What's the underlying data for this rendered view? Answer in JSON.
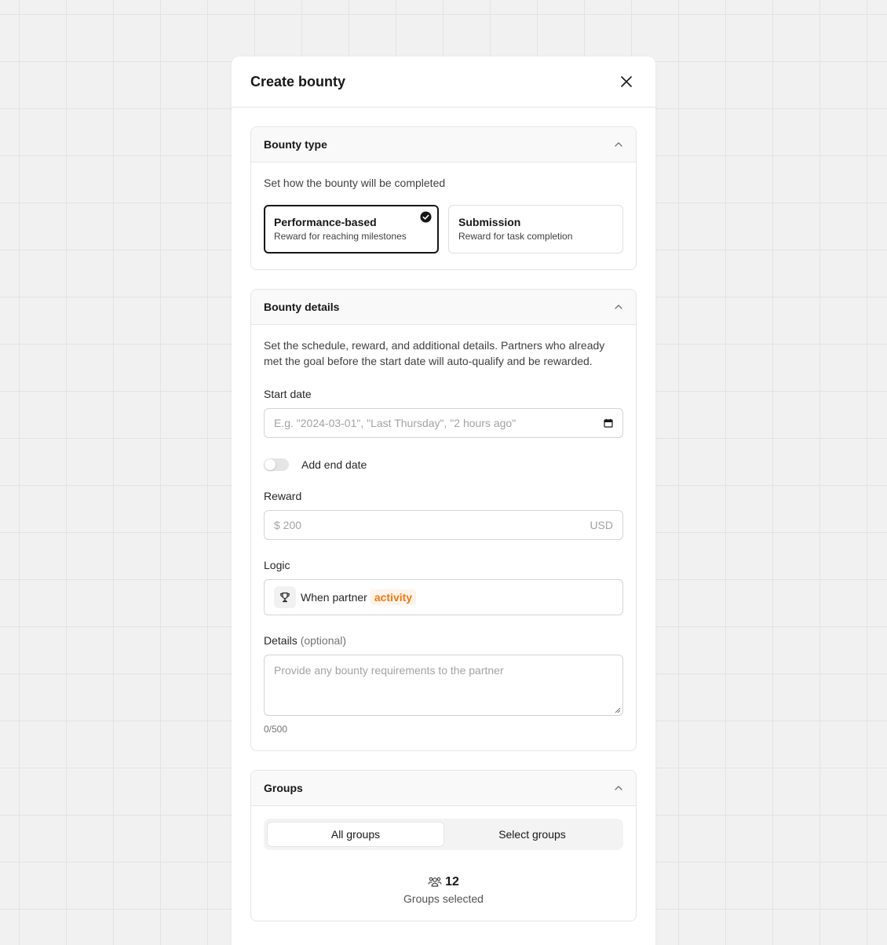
{
  "modal": {
    "title": "Create bounty"
  },
  "bounty_type": {
    "title": "Bounty type",
    "description": "Set how the bounty will be completed",
    "options": [
      {
        "name": "Performance-based",
        "description": "Reward for reaching milestones",
        "selected": true
      },
      {
        "name": "Submission",
        "description": "Reward for task completion",
        "selected": false
      }
    ]
  },
  "bounty_details": {
    "title": "Bounty details",
    "description": "Set the schedule, reward, and additional details. Partners who already met the goal before the start date will auto-qualify and be rewarded.",
    "start_date": {
      "label": "Start date",
      "placeholder": "E.g. \"2024-03-01\", \"Last Thursday\", \"2 hours ago\""
    },
    "end_date_toggle": {
      "label": "Add end date",
      "on": false
    },
    "reward": {
      "label": "Reward",
      "placeholder": "$ 200",
      "currency": "USD"
    },
    "logic": {
      "label": "Logic",
      "text": "When partner",
      "chip": "activity"
    },
    "details": {
      "label": "Details",
      "optional": "(optional)",
      "placeholder": "Provide any bounty requirements to the partner",
      "counter": "0/500"
    }
  },
  "groups": {
    "title": "Groups",
    "tabs": [
      "All groups",
      "Select groups"
    ],
    "active_tab": "All groups",
    "count": "12",
    "count_label": "Groups selected"
  },
  "colors": {
    "accent_orange": "#ea7a16",
    "primary": "#171717"
  }
}
